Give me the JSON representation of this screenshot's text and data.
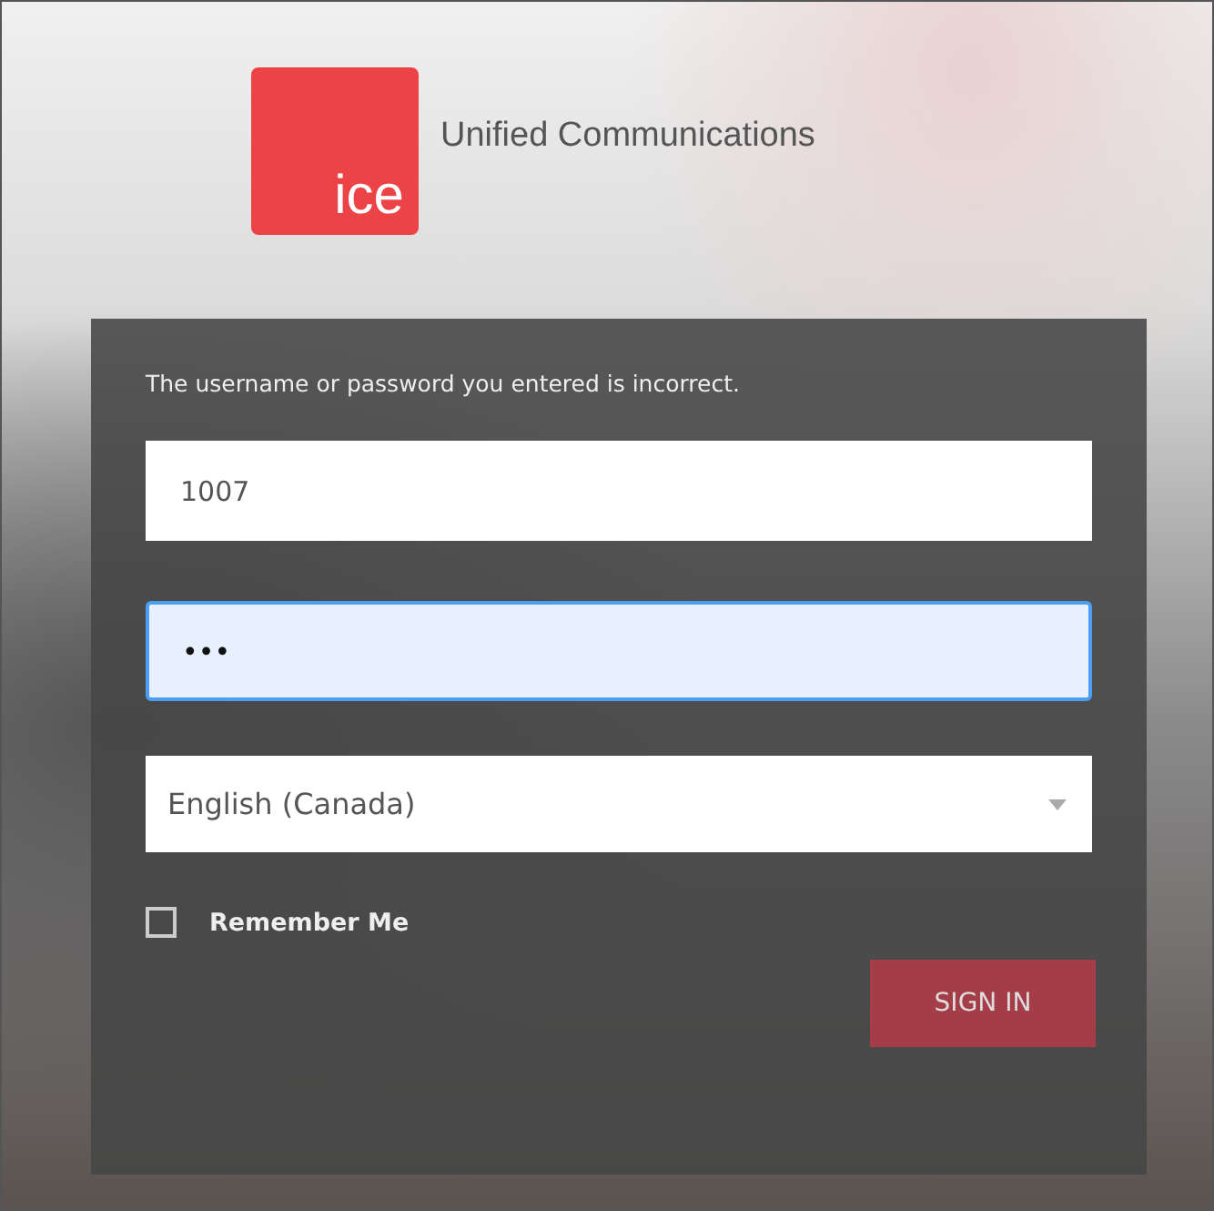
{
  "brand": {
    "logo_text": "ice",
    "title": "Unified Communications"
  },
  "login": {
    "error": "The username or password you entered is incorrect.",
    "username": {
      "value": "1007",
      "focused": false
    },
    "password": {
      "value": "•••",
      "focused": true
    },
    "language": {
      "value": "English (Canada)"
    },
    "remember": {
      "label": "Remember Me",
      "checked": false
    },
    "submit": {
      "label": "SIGN IN"
    }
  }
}
